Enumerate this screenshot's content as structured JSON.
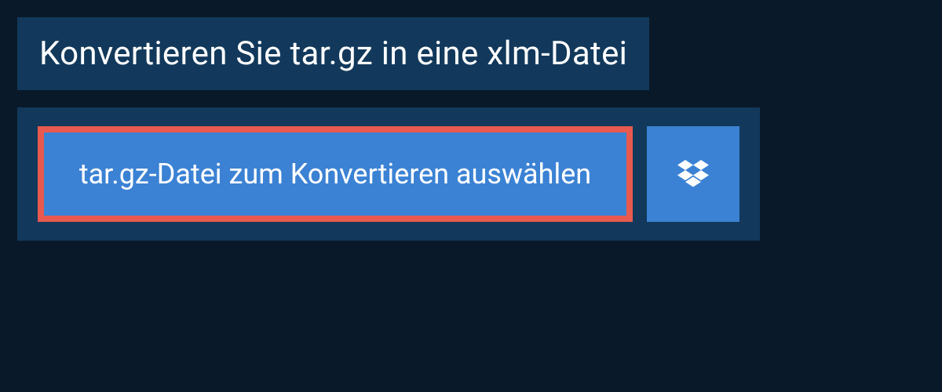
{
  "header": {
    "title": "Konvertieren Sie tar.gz in eine xlm-Datei"
  },
  "upload": {
    "select_button_label": "tar.gz-Datei zum Konvertieren auswählen",
    "dropbox_icon_name": "dropbox-icon"
  },
  "colors": {
    "page_bg": "#0a1929",
    "panel_bg": "#12395b",
    "button_bg": "#3b82d4",
    "highlight_border": "#e85a4f",
    "text": "#ffffff"
  }
}
